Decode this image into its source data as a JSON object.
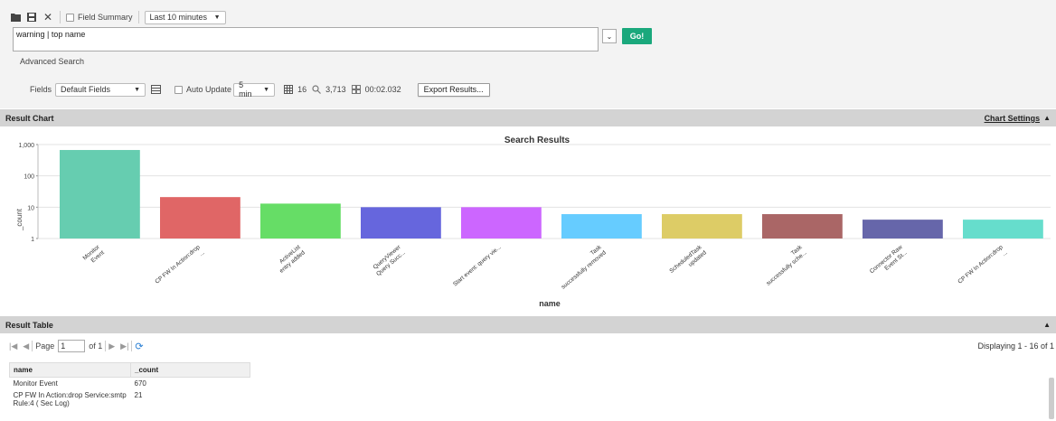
{
  "toolbar": {
    "field_summary_label": "Field Summary",
    "time_range": "Last 10 minutes"
  },
  "query": {
    "value": "warning | top name",
    "go_label": "Go!",
    "advanced_search_label": "Advanced Search"
  },
  "options": {
    "fields_label": "Fields",
    "fields_value": "Default Fields",
    "auto_update_label": "Auto Update",
    "auto_update_value": "5 min",
    "field_count": "16",
    "event_count": "3,713",
    "elapsed": "00:02.032",
    "export_label": "Export Results..."
  },
  "result_chart": {
    "header": "Result Chart",
    "settings_label": "Chart Settings"
  },
  "chart_data": {
    "type": "bar",
    "title": "Search Results",
    "xlabel": "name",
    "ylabel": "_count",
    "yscale": "log",
    "ylim": [
      1,
      1000
    ],
    "yticks": [
      "1",
      "10",
      "100",
      "1,000"
    ],
    "grid": true,
    "categories": [
      [
        "Monitor",
        "Event"
      ],
      [
        "CP FW In  Action:drop",
        "..."
      ],
      [
        "ActiveList",
        "entry added"
      ],
      [
        "QueryViewer",
        "Query Succ..."
      ],
      [
        "Start event: query vie..."
      ],
      [
        "Task",
        "successfully removed"
      ],
      [
        "ScheduledTask",
        "updated"
      ],
      [
        "Task",
        "successfully sche..."
      ],
      [
        "Connector Raw",
        "Event St..."
      ],
      [
        "CP FW In  Action:drop",
        "..."
      ]
    ],
    "values": [
      670,
      21,
      13,
      10,
      10,
      6,
      6,
      6,
      4,
      4
    ],
    "colors": [
      "#66cdb0",
      "#e06666",
      "#66dd66",
      "#6666dd",
      "#cc66ff",
      "#66ccff",
      "#ddcc66",
      "#aa6666",
      "#6666aa",
      "#66ddcc"
    ]
  },
  "result_table": {
    "header": "Result Table",
    "page_label": "Page",
    "page_value": "1",
    "of_label": "of 1",
    "displaying": "Displaying 1 - 16 of 1",
    "columns": [
      "name",
      "_count"
    ],
    "rows": [
      [
        "Monitor Event",
        "670"
      ],
      [
        "CP FW In Action:drop Service:smtp Rule:4 ( Sec Log)",
        "21"
      ]
    ]
  }
}
